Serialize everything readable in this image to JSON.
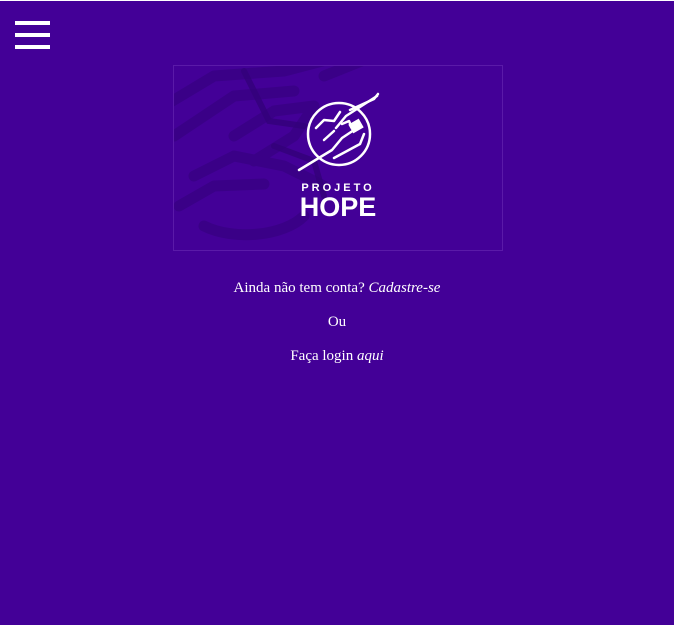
{
  "colors": {
    "background": "#430097",
    "text": "#ffffff"
  },
  "header": {
    "menu_icon": "hamburger-menu-icon"
  },
  "hero": {
    "logo_line1": "PROJETO",
    "logo_line2": "HOPE"
  },
  "auth": {
    "signup_prompt": "Ainda não tem conta?",
    "signup_link": "Cadastre-se",
    "separator": "Ou",
    "login_prompt": "Faça login",
    "login_link": "aqui"
  }
}
